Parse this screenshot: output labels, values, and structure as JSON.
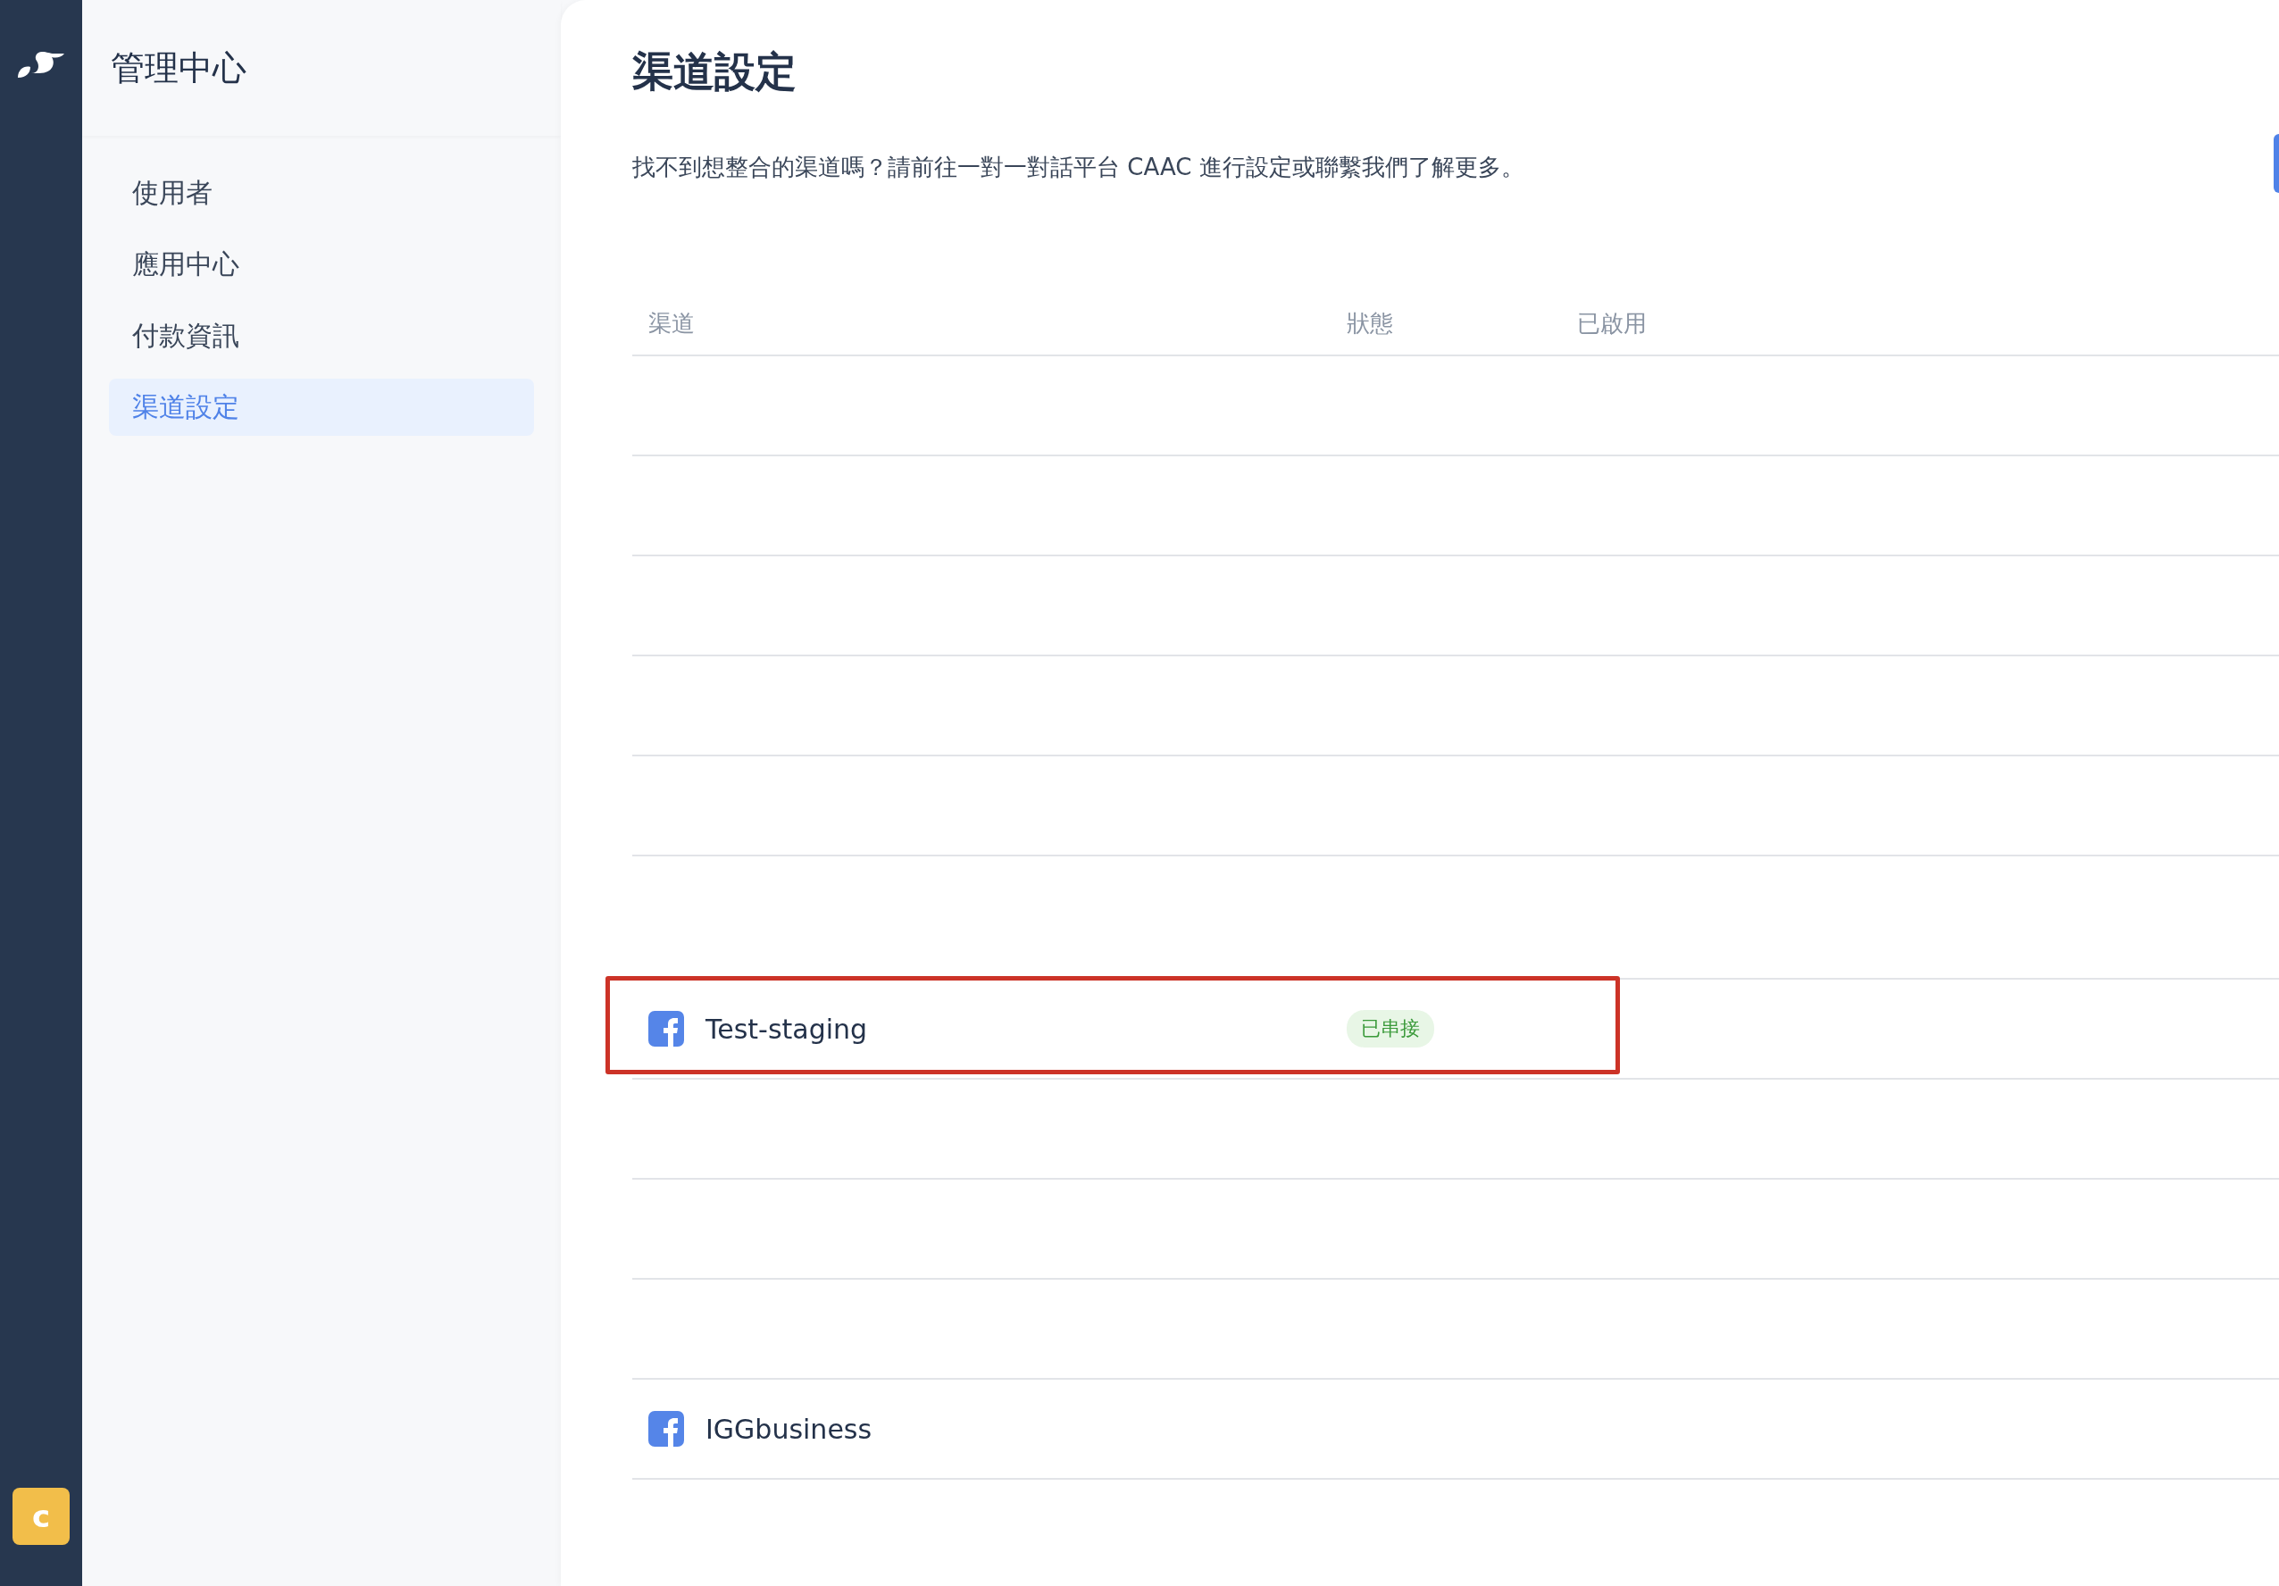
{
  "sidebar": {
    "title": "管理中心",
    "items": [
      {
        "label": "使用者",
        "selected": false
      },
      {
        "label": "應用中心",
        "selected": false
      },
      {
        "label": "付款資訊",
        "selected": false
      },
      {
        "label": "渠道設定",
        "selected": true
      }
    ]
  },
  "user": {
    "initial": "c"
  },
  "page": {
    "title": "渠道設定",
    "description": "找不到想整合的渠道嗎？請前往一對一對話平台 CAAC 進行設定或聯繫我們了解更多。"
  },
  "table": {
    "columns": [
      "渠道",
      "狀態",
      "已啟用"
    ],
    "rows": [
      {
        "kind": "blank"
      },
      {
        "kind": "blank"
      },
      {
        "kind": "blank"
      },
      {
        "kind": "blank"
      },
      {
        "kind": "blank"
      },
      {
        "kind": "gap"
      },
      {
        "kind": "channel",
        "name": "Test-staging",
        "status": "已串接",
        "highlighted": true
      },
      {
        "kind": "blank"
      },
      {
        "kind": "blank"
      },
      {
        "kind": "blank"
      },
      {
        "kind": "channel",
        "name": "IGGbusiness",
        "highlighted": false
      }
    ]
  }
}
